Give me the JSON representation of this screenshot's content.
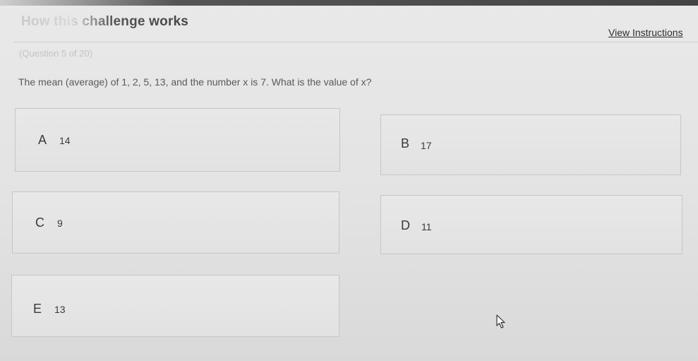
{
  "header": {
    "title": "How this challenge works",
    "view_instructions": "View Instructions"
  },
  "progress": {
    "text": "(Question 5 of 20)",
    "current": 5,
    "total": 20
  },
  "question": {
    "text": "The mean (average) of 1, 2, 5, 13, and the number x is 7. What is the value of x?"
  },
  "choices": [
    {
      "letter": "A",
      "value": "14"
    },
    {
      "letter": "B",
      "value": "17"
    },
    {
      "letter": "C",
      "value": "9"
    },
    {
      "letter": "D",
      "value": "11"
    },
    {
      "letter": "E",
      "value": "13"
    }
  ],
  "icons": {
    "cursor": "mouse-pointer-icon"
  },
  "colors": {
    "background": "#e5e5e5",
    "topbar": "#444444",
    "border": "#c6c6c6",
    "muted_text": "#c4c4c4"
  }
}
